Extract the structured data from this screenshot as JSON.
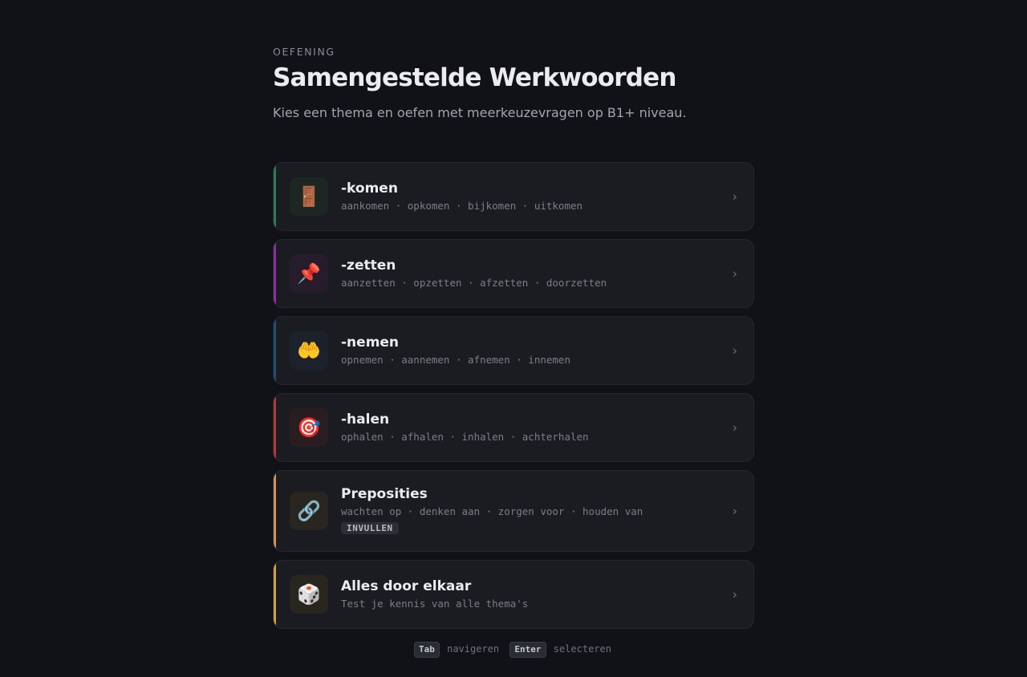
{
  "header": {
    "eyebrow": "OEFENING",
    "title": "Samengestelde Werkwoorden",
    "subtitle": "Kies een thema en oefen met meerkeuzevragen op B1+ niveau."
  },
  "themes": [
    {
      "title": "-komen",
      "items": "aankomen · opkomen · bijkomen · uitkomen",
      "icon": "door-icon",
      "glyph": "🚪",
      "accent": "#2f7a52",
      "icon_bg": "#1c2623"
    },
    {
      "title": "-zetten",
      "items": "aanzetten · opzetten · afzetten · doorzetten",
      "icon": "pushpin-icon",
      "glyph": "📌",
      "accent": "#8a2f9e",
      "icon_bg": "#261c2b"
    },
    {
      "title": "-nemen",
      "items": "opnemen · aannemen · afnemen · innemen",
      "icon": "palms-up-icon",
      "glyph": "🤲",
      "accent": "#1f4f75",
      "icon_bg": "#1b222b"
    },
    {
      "title": "-halen",
      "items": "ophalen · afhalen · inhalen · achterhalen",
      "icon": "dart-target-icon",
      "glyph": "🎯",
      "accent": "#b33a35",
      "icon_bg": "#2a1d1f"
    },
    {
      "title": "Preposities",
      "items": "wachten op · denken aan · zorgen voor · houden van",
      "badge": "INVULLEN",
      "icon": "link-icon",
      "glyph": "🔗",
      "accent": "#d3915a",
      "icon_bg": "#29251f"
    },
    {
      "title": "Alles door elkaar",
      "items": "Test je kennis van alle thema's",
      "icon": "dice-icon",
      "glyph": "🎲",
      "accent": "#d1a043",
      "icon_bg": "#29261e"
    }
  ],
  "chevron": "›",
  "footer": {
    "key1": "Tab",
    "label1": "navigeren",
    "key2": "Enter",
    "label2": "selecteren"
  }
}
